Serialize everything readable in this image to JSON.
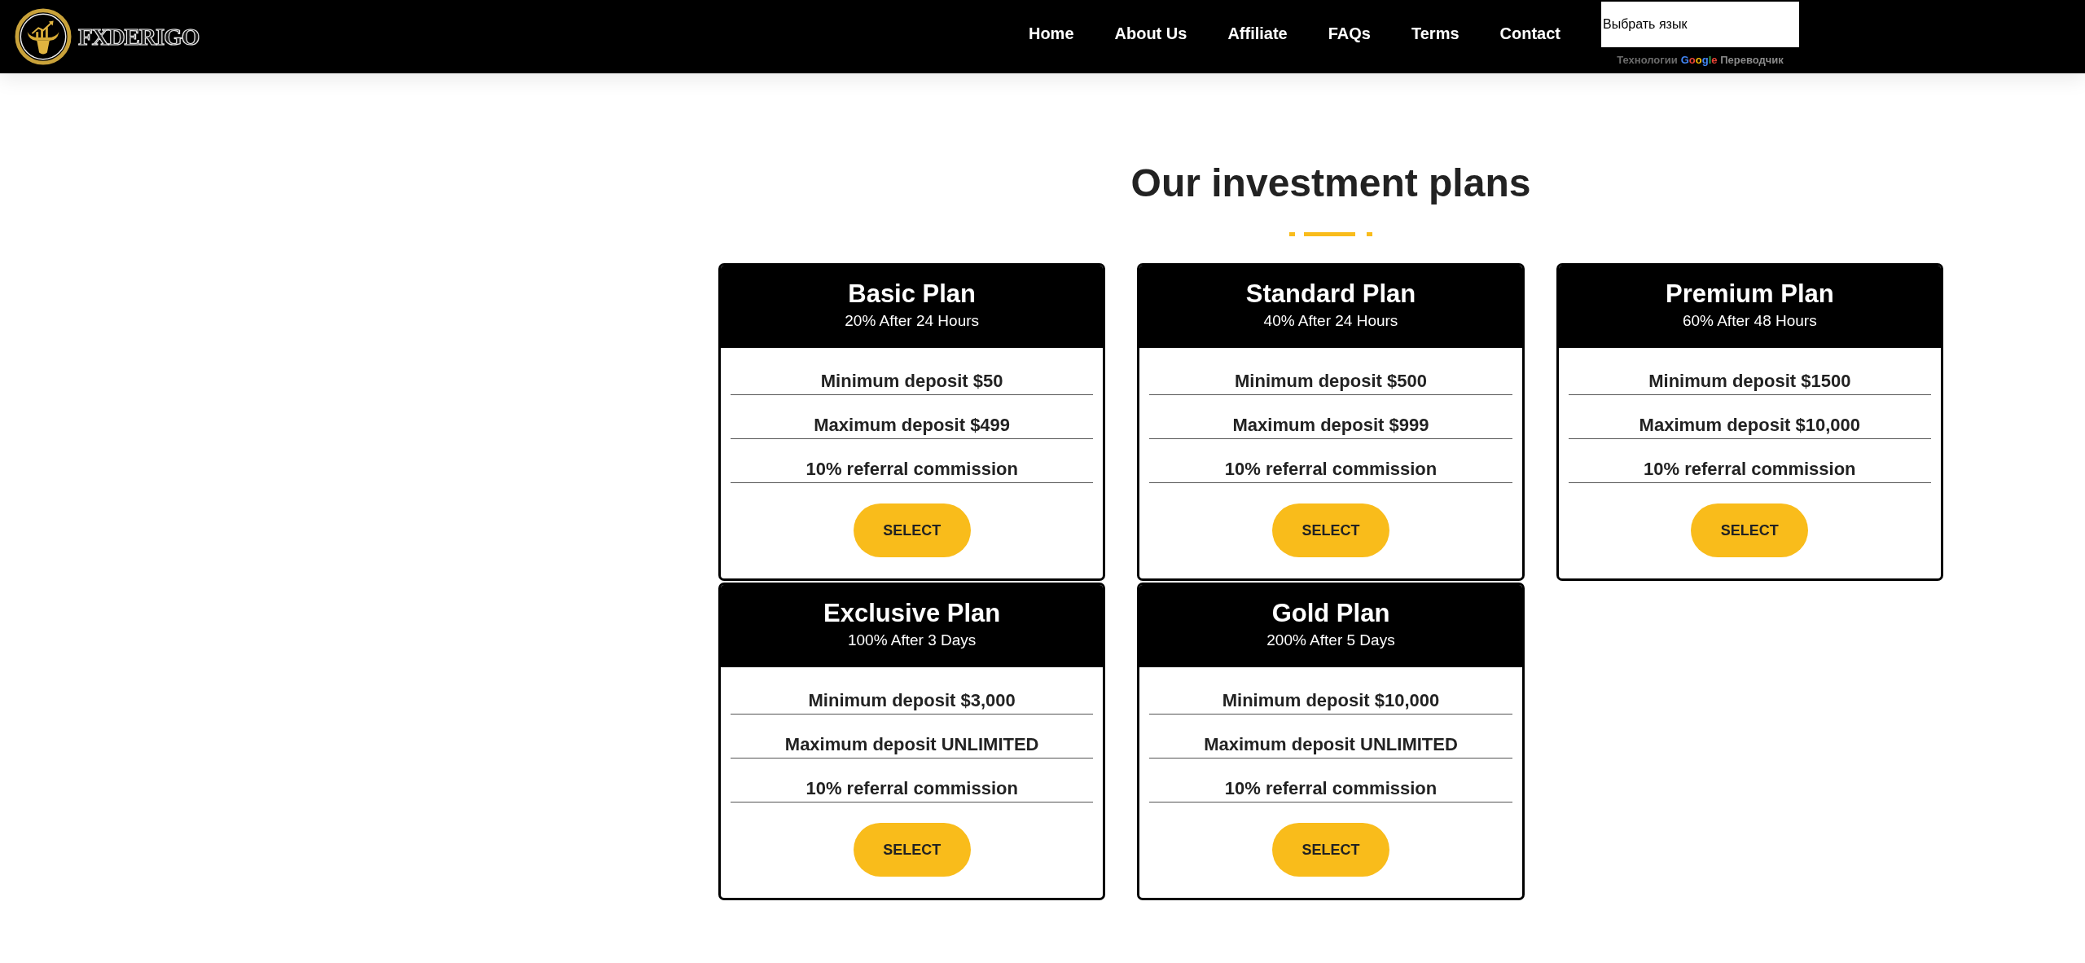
{
  "header": {
    "logo_text": "FXDERIGO",
    "nav": [
      "Home",
      "About Us",
      "Affiliate",
      "FAQs",
      "Terms",
      "Contact"
    ],
    "translate": {
      "select_label": "Выбрать язык",
      "powered_by": "Технологии",
      "brand": "Google",
      "service": "Переводчик"
    }
  },
  "plans_section": {
    "title": "Our investment plans",
    "plans": [
      {
        "name": "Basic Plan",
        "return": "20% After 24 Hours",
        "features": [
          "Minimum deposit $50",
          "Maximum deposit $499",
          "10% referral commission"
        ],
        "button": "SELECT"
      },
      {
        "name": "Standard Plan",
        "return": "40% After 24 Hours",
        "features": [
          "Minimum deposit $500",
          "Maximum deposit $999",
          "10% referral commission"
        ],
        "button": "SELECT"
      },
      {
        "name": "Premium Plan",
        "return": "60% After 48 Hours",
        "features": [
          "Minimum deposit $1500",
          "Maximum deposit $10,000",
          "10% referral commission"
        ],
        "button": "SELECT"
      },
      {
        "name": "Exclusive Plan",
        "return": "100% After 3 Days",
        "features": [
          "Minimum deposit $3,000",
          "Maximum deposit UNLIMITED",
          "10% referral commission"
        ],
        "button": "SELECT"
      },
      {
        "name": "Gold Plan",
        "return": "200% After 5 Days",
        "features": [
          "Minimum deposit $10,000",
          "Maximum deposit UNLIMITED",
          "10% referral commission"
        ],
        "button": "SELECT"
      }
    ]
  }
}
